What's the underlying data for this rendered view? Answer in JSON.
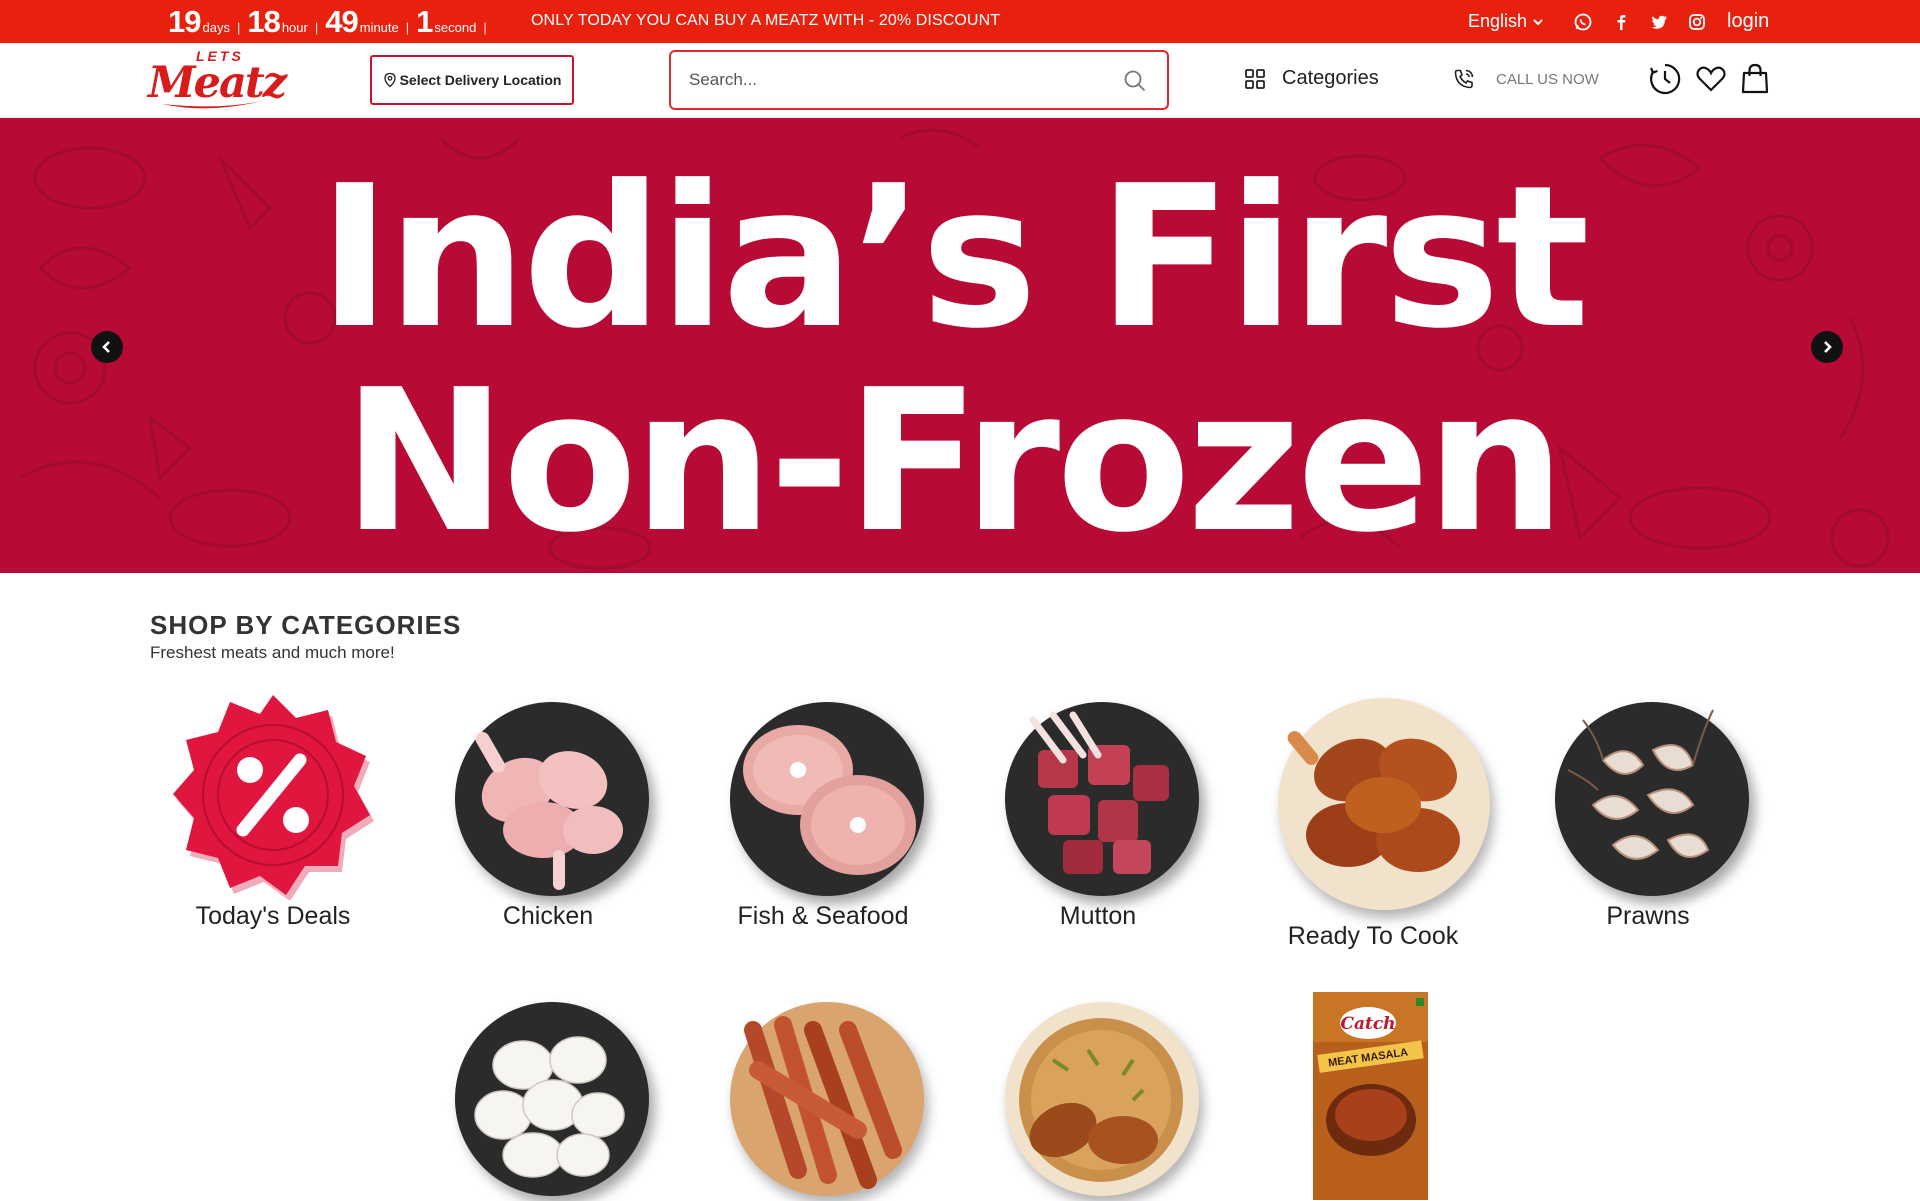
{
  "topbar": {
    "countdown": [
      {
        "num": "19",
        "unit": "days"
      },
      {
        "num": "18",
        "unit": "hour"
      },
      {
        "num": "49",
        "unit": "minute"
      },
      {
        "num": "1",
        "unit": "second"
      }
    ],
    "separator": "|",
    "promo": "ONLY TODAY YOU CAN BUY A MEATZ WITH - 20% DISCOUNT",
    "language": "English",
    "social_icons": [
      "whatsapp-icon",
      "facebook-icon",
      "twitter-icon",
      "instagram-icon"
    ],
    "login": "login",
    "color": "#e8210f"
  },
  "header": {
    "logo_top": "LETS",
    "logo_main": "Meatz",
    "delivery_location": "Select Delivery Location",
    "search_placeholder": "Search...",
    "categories": "Categories",
    "call_us": "CALL US NOW",
    "icons": [
      "history-icon",
      "heart-icon",
      "bag-icon"
    ],
    "accent": "#d81b1b"
  },
  "banner": {
    "line1": "India’s First",
    "line2": "Non-Frozen",
    "background": "#b70a35"
  },
  "shop": {
    "title": "SHOP BY CATEGORIES",
    "subtitle": "Freshest meats and much more!",
    "categories": [
      {
        "label": "Today's Deals"
      },
      {
        "label": "Chicken"
      },
      {
        "label": "Fish & Seafood"
      },
      {
        "label": "Mutton"
      },
      {
        "label": "Ready To Cook"
      },
      {
        "label": "Prawns"
      },
      {
        "label": ""
      },
      {
        "label": ""
      },
      {
        "label": ""
      },
      {
        "label": ""
      }
    ],
    "masala_brand": "Catch",
    "masala_name": "MEAT MASALA"
  }
}
